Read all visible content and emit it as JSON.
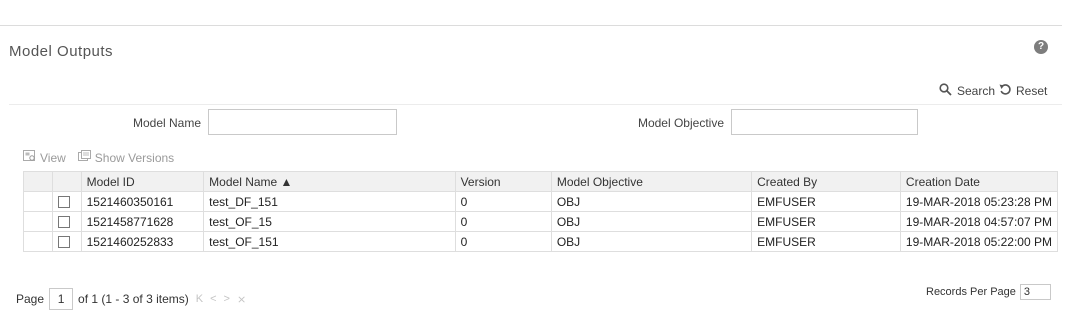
{
  "page": {
    "title": "Model Outputs",
    "help_glyph": "?"
  },
  "actions": {
    "search_label": "Search",
    "reset_label": "Reset"
  },
  "filters": {
    "model_name_label": "Model Name",
    "model_name_value": "",
    "model_objective_label": "Model Objective",
    "model_objective_value": ""
  },
  "toolbar": {
    "view_label": "View",
    "show_versions_label": "Show Versions"
  },
  "table": {
    "columns": [
      "Model ID",
      "Model Name ▲",
      "Version",
      "Model Objective",
      "Created By",
      "Creation Date"
    ],
    "rows": [
      {
        "model_id": "1521460350161",
        "model_name": "test_DF_151",
        "version": "0",
        "objective": "OBJ",
        "created_by": "EMFUSER",
        "creation_date": "19-MAR-2018 05:23:28 PM"
      },
      {
        "model_id": "1521458771628",
        "model_name": "test_OF_15",
        "version": "0",
        "objective": "OBJ",
        "created_by": "EMFUSER",
        "creation_date": "19-MAR-2018 04:57:07 PM"
      },
      {
        "model_id": "1521460252833",
        "model_name": "test_OF_151",
        "version": "0",
        "objective": "OBJ",
        "created_by": "EMFUSER",
        "creation_date": "19-MAR-2018 05:22:00 PM"
      }
    ]
  },
  "pagination": {
    "page_label": "Page",
    "current_page": "1",
    "summary": "of 1 (1 - 3 of 3 items)",
    "first_icon": "K",
    "prev_icon": "<",
    "next_icon": ">",
    "last_icon": "⨯",
    "records_per_page_label": "Records Per Page",
    "records_per_page_value": "3"
  }
}
